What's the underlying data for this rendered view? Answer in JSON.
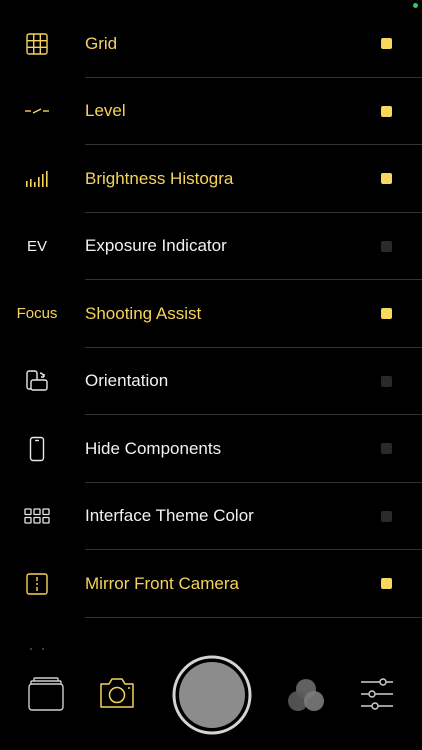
{
  "settings": [
    {
      "label": "Grid",
      "icon": "grid-icon",
      "enabled": true
    },
    {
      "label": "Level",
      "icon": "level-icon",
      "enabled": true
    },
    {
      "label": "Brightness Histogra",
      "icon": "histogram-icon",
      "enabled": true
    },
    {
      "label": "Exposure Indicator",
      "icon": "ev-icon",
      "icon_text": "EV",
      "enabled": false
    },
    {
      "label": "Shooting Assist",
      "icon": "focus-icon",
      "icon_text": "Focus",
      "enabled": true
    },
    {
      "label": "Orientation",
      "icon": "orientation-icon",
      "enabled": false
    },
    {
      "label": "Hide Components",
      "icon": "phone-icon",
      "enabled": false
    },
    {
      "label": "Interface Theme Color",
      "icon": "theme-grid-icon",
      "enabled": false
    },
    {
      "label": "Mirror Front Camera",
      "icon": "mirror-icon",
      "enabled": true
    }
  ],
  "toolbar": {
    "items": [
      "gallery-icon",
      "camera-icon",
      "shutter-button",
      "filters-icon",
      "sliders-icon"
    ]
  },
  "colors": {
    "accent": "#f5d35c",
    "check_on": "#f8d95e",
    "check_off": "#2a2a2a",
    "text_off": "#f2f2f2",
    "divider": "#333333",
    "background": "#000000"
  }
}
